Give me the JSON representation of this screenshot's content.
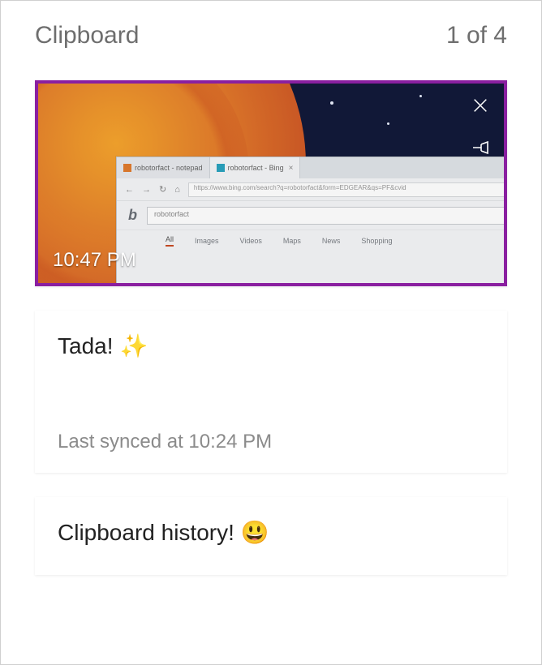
{
  "header": {
    "title": "Clipboard",
    "position": "1 of 4"
  },
  "items": [
    {
      "kind": "image",
      "timestamp": "10:47 PM",
      "selected": true,
      "actions": {
        "close_icon": "close-icon",
        "pin_icon": "pin-icon"
      },
      "thumb": {
        "tab1": "robotorfact - notepad",
        "tab2": "robotorfact - Bing",
        "url": "https://www.bing.com/search?q=robotorfact&form=EDGEAR&qs=PF&cvid",
        "query": "robotorfact",
        "nav": [
          "All",
          "Images",
          "Videos",
          "Maps",
          "News",
          "Shopping"
        ]
      }
    },
    {
      "kind": "text",
      "text": "Tada!",
      "emoji": "✨",
      "sync_status": "Last synced at 10:24 PM"
    },
    {
      "kind": "text",
      "text": "Clipboard history!",
      "emoji": "😃"
    }
  ]
}
